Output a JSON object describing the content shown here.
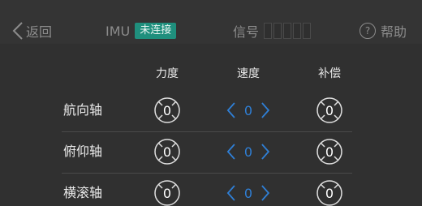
{
  "header": {
    "back_label": "返回",
    "imu_label": "IMU",
    "imu_status": "未连接",
    "signal_label": "信号",
    "help_label": "帮助",
    "help_icon_glyph": "?"
  },
  "columns": [
    "力度",
    "速度",
    "补偿"
  ],
  "rows": [
    {
      "label": "航向轴",
      "force": "0",
      "speed": "0",
      "comp": "0"
    },
    {
      "label": "俯仰轴",
      "force": "0",
      "speed": "0",
      "comp": "0"
    },
    {
      "label": "横滚轴",
      "force": "0",
      "speed": "0",
      "comp": "0"
    }
  ],
  "colors": {
    "background": "#303030",
    "accent_blue": "#2f7fd6",
    "status_teal": "#1f8f7d"
  }
}
